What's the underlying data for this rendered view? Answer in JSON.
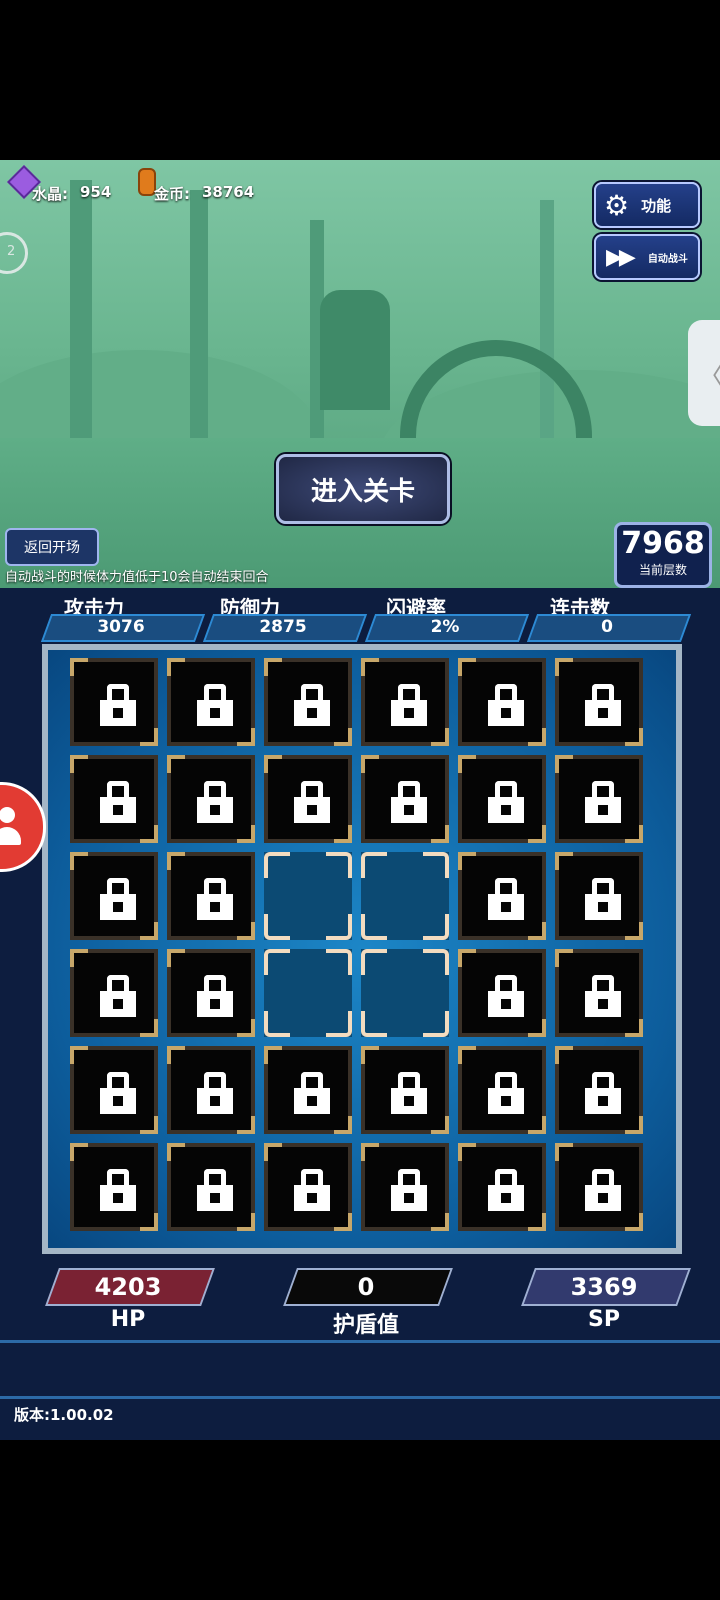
{
  "resources": {
    "crystal": {
      "label": "水晶:",
      "value": "954"
    },
    "gold": {
      "label": "金币:",
      "value": "38764"
    }
  },
  "top_buttons": {
    "function": "功能",
    "auto_battle": "自动战斗"
  },
  "left_circle_text": "2",
  "enter_stage": "进入关卡",
  "back_to_start": "返回开场",
  "notice": "自动战斗的时候体力值低于10会自动结束回合",
  "floor": {
    "value": "7968",
    "label": "当前层数"
  },
  "stats": [
    {
      "label": "攻击力",
      "value": "3076"
    },
    {
      "label": "防御力",
      "value": "2875"
    },
    {
      "label": "闪避率",
      "value": "2%"
    },
    {
      "label": "连击数",
      "value": "0"
    }
  ],
  "grid": {
    "rows": [
      [
        "locked",
        "locked",
        "locked",
        "locked",
        "locked",
        "locked"
      ],
      [
        "locked",
        "locked",
        "locked",
        "locked",
        "locked",
        "locked"
      ],
      [
        "locked",
        "locked",
        "open",
        "open",
        "locked",
        "locked"
      ],
      [
        "locked",
        "locked",
        "open",
        "open",
        "locked",
        "locked"
      ],
      [
        "locked",
        "locked",
        "locked",
        "locked",
        "locked",
        "locked"
      ],
      [
        "locked",
        "locked",
        "locked",
        "locked",
        "locked",
        "locked"
      ]
    ]
  },
  "vitals": {
    "hp": {
      "label": "HP",
      "value": "4203"
    },
    "shield": {
      "label": "护盾值",
      "value": "0"
    },
    "sp": {
      "label": "SP",
      "value": "3369"
    }
  },
  "version": "版本:1.00.02",
  "colors": {
    "hp_bar": "#7a2233",
    "shield_bar": "#090909",
    "sp_bar": "#323a6e"
  }
}
